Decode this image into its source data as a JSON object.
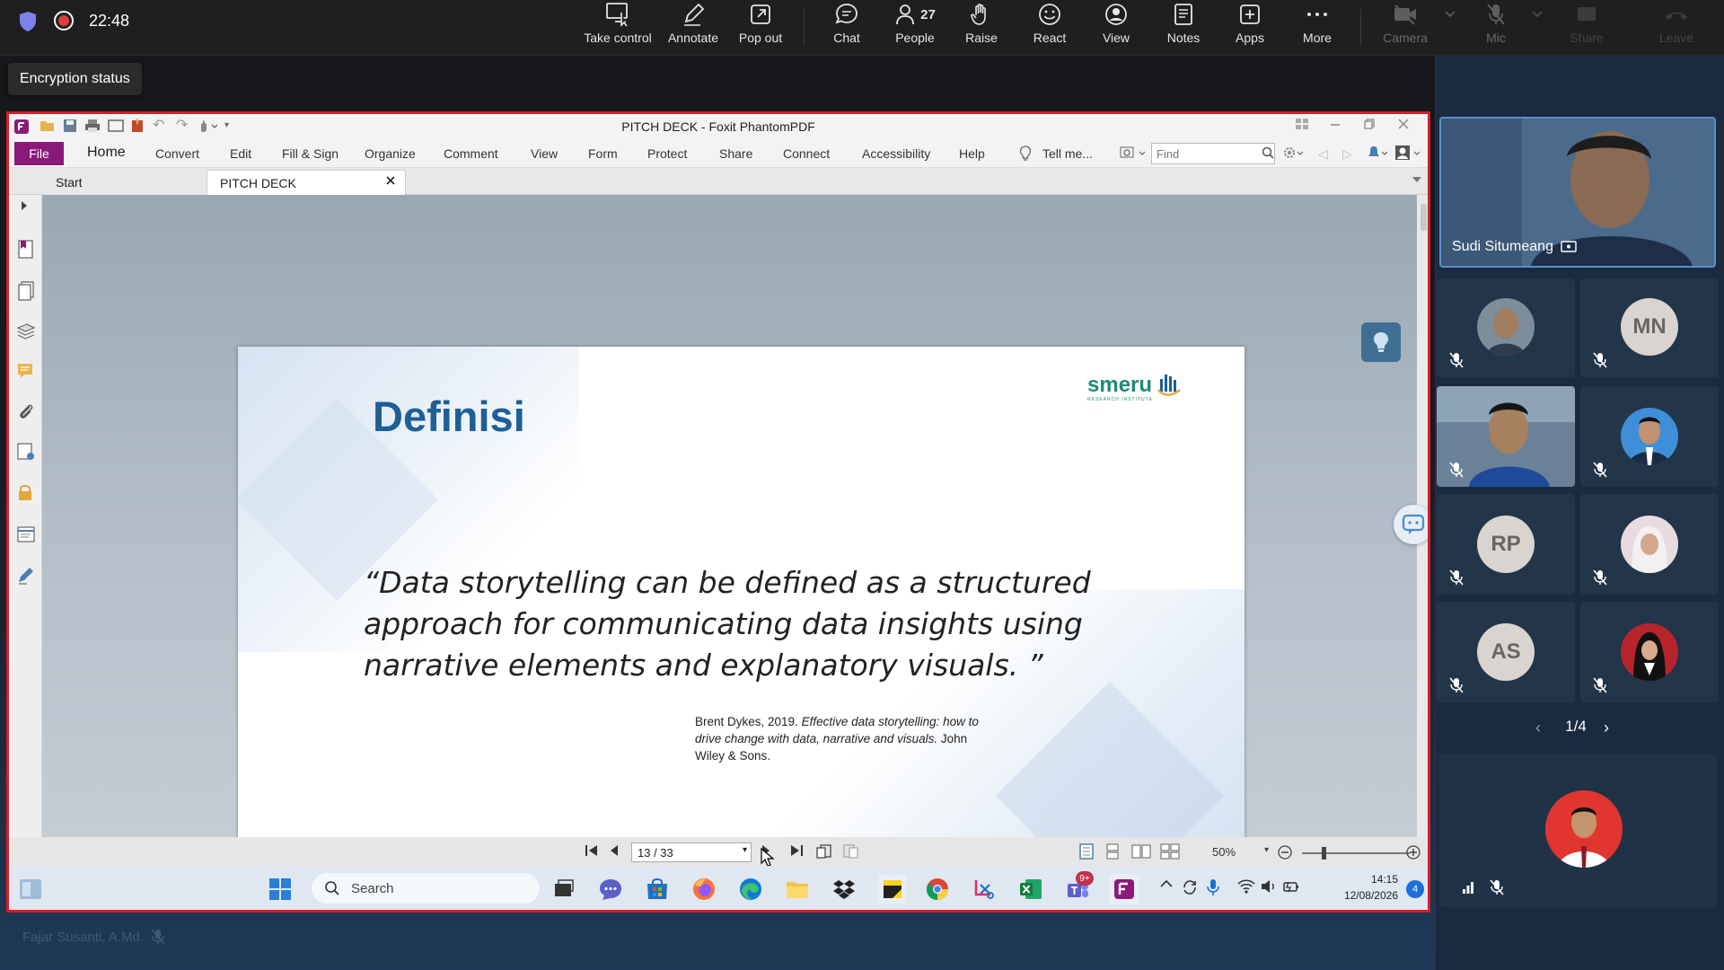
{
  "meeting": {
    "clock": "22:48",
    "tooltip": "Encryption status",
    "people_count": "27",
    "toolbar": [
      {
        "label": "Take control",
        "icon": "take-control-icon"
      },
      {
        "label": "Annotate",
        "icon": "pen-icon"
      },
      {
        "label": "Pop out",
        "icon": "pop-out-icon"
      },
      {
        "label": "Chat",
        "icon": "chat-icon"
      },
      {
        "label": "People",
        "icon": "people-icon"
      },
      {
        "label": "Raise",
        "icon": "hand-icon"
      },
      {
        "label": "React",
        "icon": "smiley-icon"
      },
      {
        "label": "View",
        "icon": "view-icon"
      },
      {
        "label": "Notes",
        "icon": "notes-icon"
      },
      {
        "label": "Apps",
        "icon": "apps-icon"
      },
      {
        "label": "More",
        "icon": "more-icon"
      },
      {
        "label": "Camera",
        "icon": "camera-off-icon"
      },
      {
        "label": "Mic",
        "icon": "mic-off-icon"
      },
      {
        "label": "Share",
        "icon": "share-icon"
      },
      {
        "label": "Leave",
        "icon": "phone-icon"
      }
    ],
    "presenter_label": "Fajar Susanti, A.Md."
  },
  "foxit": {
    "title": "PITCH DECK - Foxit PhantomPDF",
    "ribbon": {
      "file": "File",
      "home": "Home",
      "convert": "Convert",
      "edit": "Edit",
      "fill_sign": "Fill & Sign",
      "organize": "Organize",
      "comment": "Comment",
      "view": "View",
      "form": "Form",
      "protect": "Protect",
      "share": "Share",
      "connect": "Connect",
      "accessibility": "Accessibility",
      "help": "Help",
      "tell_me": "Tell me...",
      "find_placeholder": "Find"
    },
    "tabs": {
      "start": "Start",
      "doc": "PITCH DECK"
    },
    "page_indicator": "13 / 33",
    "zoom": "50%"
  },
  "slide": {
    "title": "Definisi",
    "logo_text": "smeru",
    "logo_subtext": "RESEARCH INSTITUTE",
    "quote": "“Data storytelling can be defined as a structured approach for communicating data insights using narrative elements and explanatory visuals. ”",
    "ref_plain_1": "Brent Dykes, 2019. ",
    "ref_italic": "Effective data storytelling: how to drive change with data, narrative and visuals.",
    "ref_plain_2": " John Wiley & Sons."
  },
  "taskbar": {
    "search_placeholder": "Search",
    "time": "14:15",
    "date": "12/08/2026",
    "notif_count": "4",
    "teams_badge": "9+"
  },
  "gallery": {
    "main_name": "Sudi Situmeang",
    "initials": [
      "MN",
      "RP",
      "AS"
    ],
    "page": "1/4"
  }
}
